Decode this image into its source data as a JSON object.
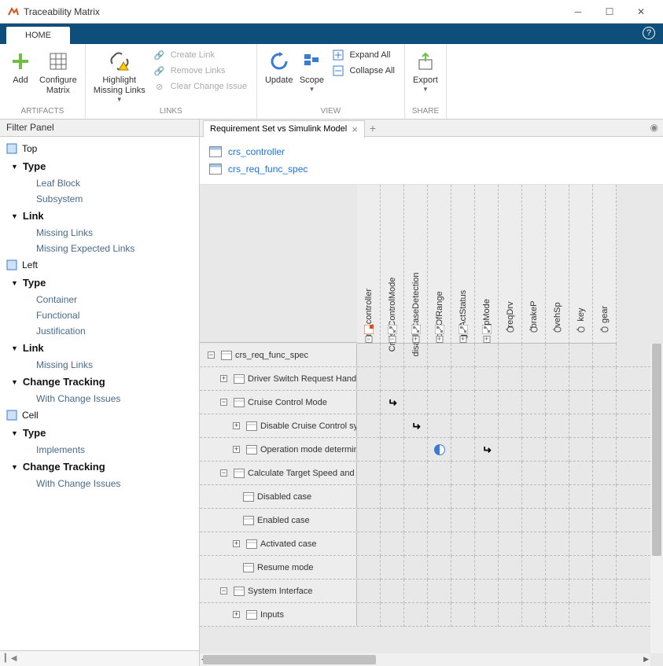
{
  "window": {
    "title": "Traceability Matrix"
  },
  "ribbon": {
    "tab": "HOME",
    "groups": {
      "artifacts": {
        "label": "ARTIFACTS",
        "add": "Add",
        "configure": "Configure\nMatrix"
      },
      "links": {
        "label": "LINKS",
        "highlight": "Highlight\nMissing Links",
        "create": "Create Link",
        "remove": "Remove Links",
        "clear": "Clear Change Issue"
      },
      "view": {
        "label": "VIEW",
        "update": "Update",
        "scope": "Scope",
        "expand": "Expand All",
        "collapse": "Collapse All"
      },
      "share": {
        "label": "SHARE",
        "export": "Export"
      }
    }
  },
  "filter": {
    "title": "Filter Panel",
    "sections": [
      {
        "name": "Top",
        "cats": [
          {
            "name": "Type",
            "items": [
              "Leaf Block",
              "Subsystem"
            ]
          },
          {
            "name": "Link",
            "items": [
              "Missing Links",
              "Missing Expected Links"
            ]
          }
        ]
      },
      {
        "name": "Left",
        "cats": [
          {
            "name": "Type",
            "items": [
              "Container",
              "Functional",
              "Justification"
            ]
          },
          {
            "name": "Link",
            "items": [
              "Missing Links"
            ]
          },
          {
            "name": "Change Tracking",
            "items": [
              "With Change Issues"
            ]
          }
        ]
      },
      {
        "name": "Cell",
        "cats": [
          {
            "name": "Type",
            "items": [
              "Implements"
            ]
          },
          {
            "name": "Change Tracking",
            "items": [
              "With Change Issues"
            ]
          }
        ]
      }
    ]
  },
  "doc": {
    "tab": "Requirement Set vs Simulink Model",
    "links": [
      "crs_controller",
      "crs_req_func_spec"
    ]
  },
  "matrix": {
    "columns": [
      {
        "label": "crs_controller",
        "icon": "model",
        "exp": "box"
      },
      {
        "label": "CruiseControlMode",
        "icon": "subsys",
        "exp": "minus"
      },
      {
        "label": "disableCaseDetection",
        "icon": "subsys",
        "exp": "plus"
      },
      {
        "label": "outOfRange",
        "icon": "subsys",
        "exp": "plus"
      },
      {
        "label": "getActStatus",
        "icon": "subsys",
        "exp": "plus"
      },
      {
        "label": "opMode",
        "icon": "subsys",
        "exp": "plus"
      },
      {
        "label": "reqDrv",
        "icon": "port"
      },
      {
        "label": "brakeP",
        "icon": "port"
      },
      {
        "label": "vehSp",
        "icon": "port"
      },
      {
        "label": "key",
        "icon": "port"
      },
      {
        "label": "gear",
        "icon": "port"
      }
    ],
    "rows": [
      {
        "indent": 0,
        "exp": "minus",
        "icon": "reqset",
        "label": "crs_req_func_spec",
        "cells": []
      },
      {
        "indent": 1,
        "exp": "plus",
        "icon": "req",
        "label": "Driver Switch Request Handling",
        "cells": []
      },
      {
        "indent": 1,
        "exp": "minus",
        "icon": "req",
        "label": "Cruise Control Mode",
        "cells": [
          {
            "col": 1,
            "type": "linked"
          }
        ]
      },
      {
        "indent": 2,
        "exp": "plus",
        "icon": "req",
        "label": "Disable Cruise Control syste",
        "cells": [
          {
            "col": 2,
            "type": "linked"
          }
        ]
      },
      {
        "indent": 2,
        "exp": "plus",
        "icon": "req",
        "label": "Operation mode determinatio",
        "cells": [
          {
            "col": 3,
            "type": "half"
          },
          {
            "col": 5,
            "type": "linked"
          }
        ]
      },
      {
        "indent": 1,
        "exp": "minus",
        "icon": "req",
        "label": "Calculate Target Speed and Th",
        "cells": []
      },
      {
        "indent": 2,
        "exp": "",
        "icon": "req",
        "label": "Disabled case",
        "cells": []
      },
      {
        "indent": 2,
        "exp": "",
        "icon": "req",
        "label": "Enabled case",
        "cells": []
      },
      {
        "indent": 2,
        "exp": "plus",
        "icon": "req",
        "label": "Activated case",
        "cells": []
      },
      {
        "indent": 2,
        "exp": "",
        "icon": "req",
        "label": "Resume mode",
        "cells": []
      },
      {
        "indent": 1,
        "exp": "minus",
        "icon": "req",
        "label": "System Interface",
        "cells": []
      },
      {
        "indent": 2,
        "exp": "plus",
        "icon": "req",
        "label": "Inputs",
        "cells": []
      }
    ]
  }
}
